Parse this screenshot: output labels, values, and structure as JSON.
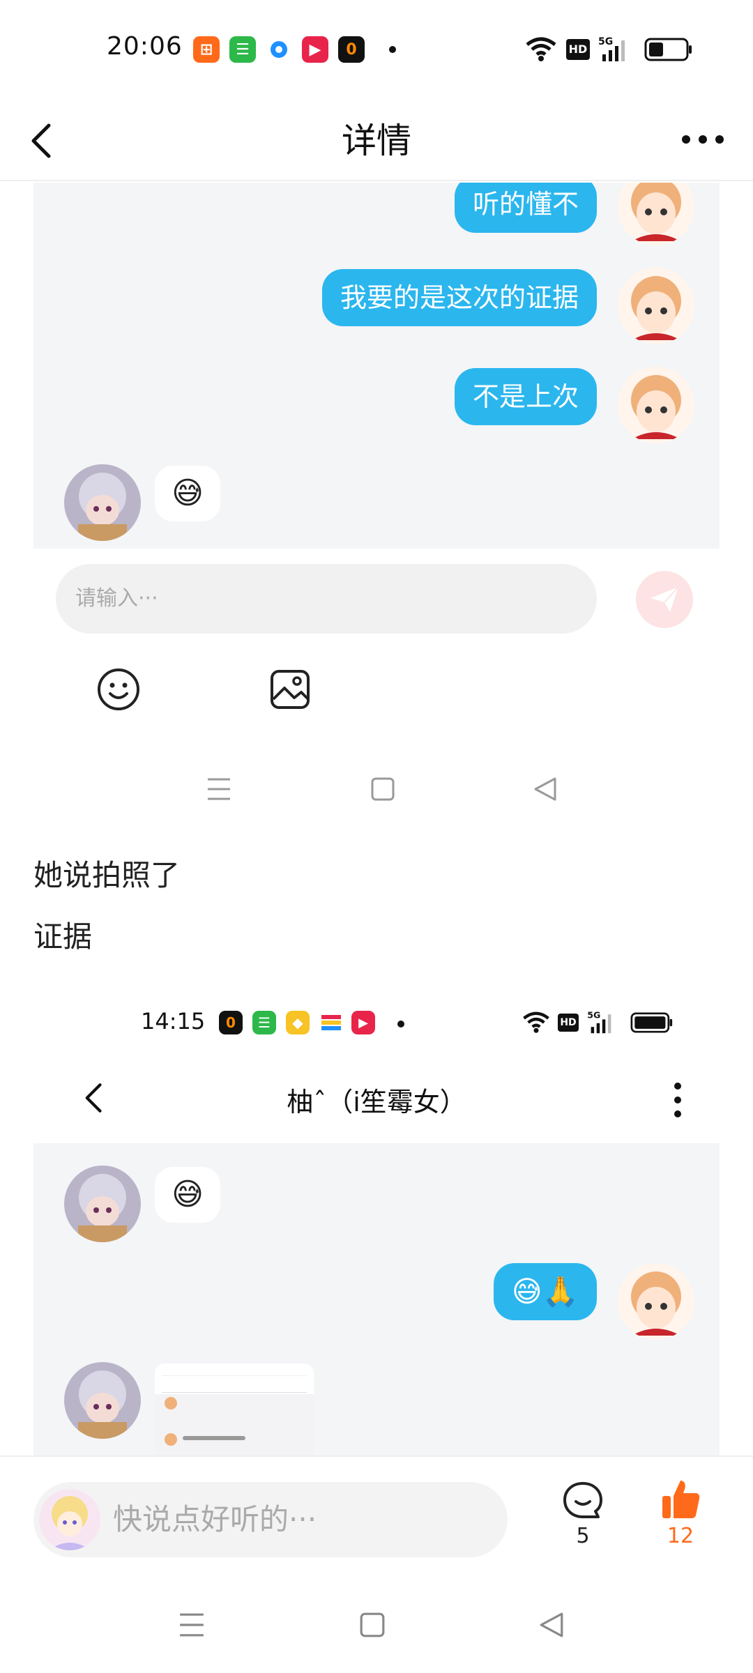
{
  "status_bar": {
    "time": "20:06"
  },
  "header": {
    "title": "详情"
  },
  "chat1": {
    "messages": [
      {
        "text": "听的懂不"
      },
      {
        "text": "我要的是这次的证据"
      },
      {
        "text": "不是上次"
      },
      {
        "text": "😅"
      }
    ],
    "input_placeholder": "请输入···"
  },
  "post": {
    "lines": [
      "她说拍照了",
      "证据"
    ]
  },
  "screenshot2": {
    "status_time": "14:15",
    "chat_title": "柚ˆ（i笙霉女）",
    "messages": [
      {
        "text": "😅"
      },
      {
        "text": "😅🙏"
      }
    ]
  },
  "bottom_bar": {
    "comment_placeholder": "快说点好听的···",
    "comment_count": "5",
    "like_count": "12"
  },
  "colors": {
    "bubble_blue": "#2bb6ee",
    "like_orange": "#ff6a1a"
  }
}
